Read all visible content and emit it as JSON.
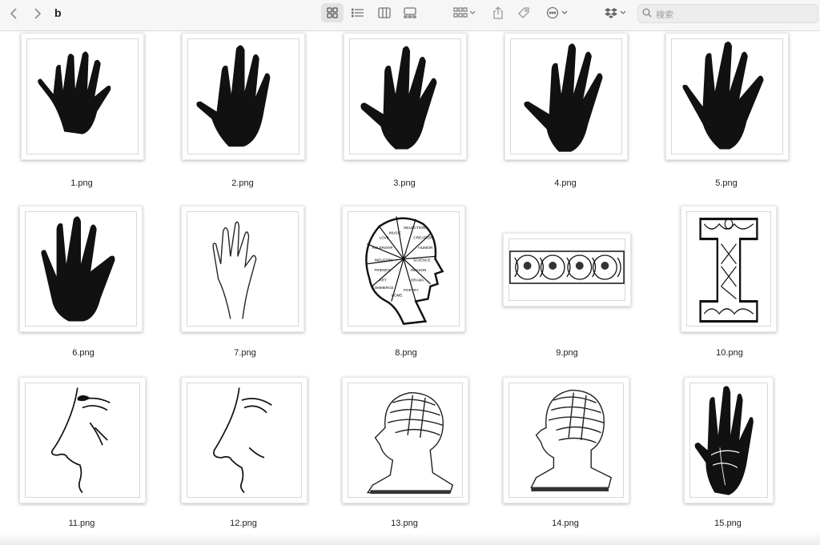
{
  "toolbar": {
    "folder_name": "b",
    "search_placeholder": "検索",
    "icons": [
      "back-icon",
      "forward-icon",
      "icon-view-icon",
      "list-view-icon",
      "column-view-icon",
      "gallery-view-icon",
      "group-icon",
      "share-icon",
      "tag-icon",
      "action-icon",
      "dropbox-icon",
      "search-icon"
    ]
  },
  "files": [
    {
      "name": "1.png",
      "kind": "handprint"
    },
    {
      "name": "2.png",
      "kind": "handprint"
    },
    {
      "name": "3.png",
      "kind": "handprint"
    },
    {
      "name": "4.png",
      "kind": "handprint"
    },
    {
      "name": "5.png",
      "kind": "handprint"
    },
    {
      "name": "6.png",
      "kind": "handprint"
    },
    {
      "name": "7.png",
      "kind": "hand-outline"
    },
    {
      "name": "8.png",
      "kind": "phrenology-head"
    },
    {
      "name": "9.png",
      "kind": "ornament-banner"
    },
    {
      "name": "10.png",
      "kind": "celtic-letter"
    },
    {
      "name": "11.png",
      "kind": "nose-profile"
    },
    {
      "name": "12.png",
      "kind": "nose-profile"
    },
    {
      "name": "13.png",
      "kind": "phrenology-bust"
    },
    {
      "name": "14.png",
      "kind": "phrenology-bust"
    },
    {
      "name": "15.png",
      "kind": "palmistry-hand"
    }
  ],
  "head_labels": [
    "MUSIC",
    "SELECTION",
    "CREATION",
    "HUMOR",
    "SCIENCE",
    "REASON",
    "DRAMA",
    "POETRY",
    "ART",
    "HOME",
    "FRIENDS",
    "COMMERCE",
    "INDUSTRY",
    "RULERSHIP",
    "LOVE"
  ]
}
